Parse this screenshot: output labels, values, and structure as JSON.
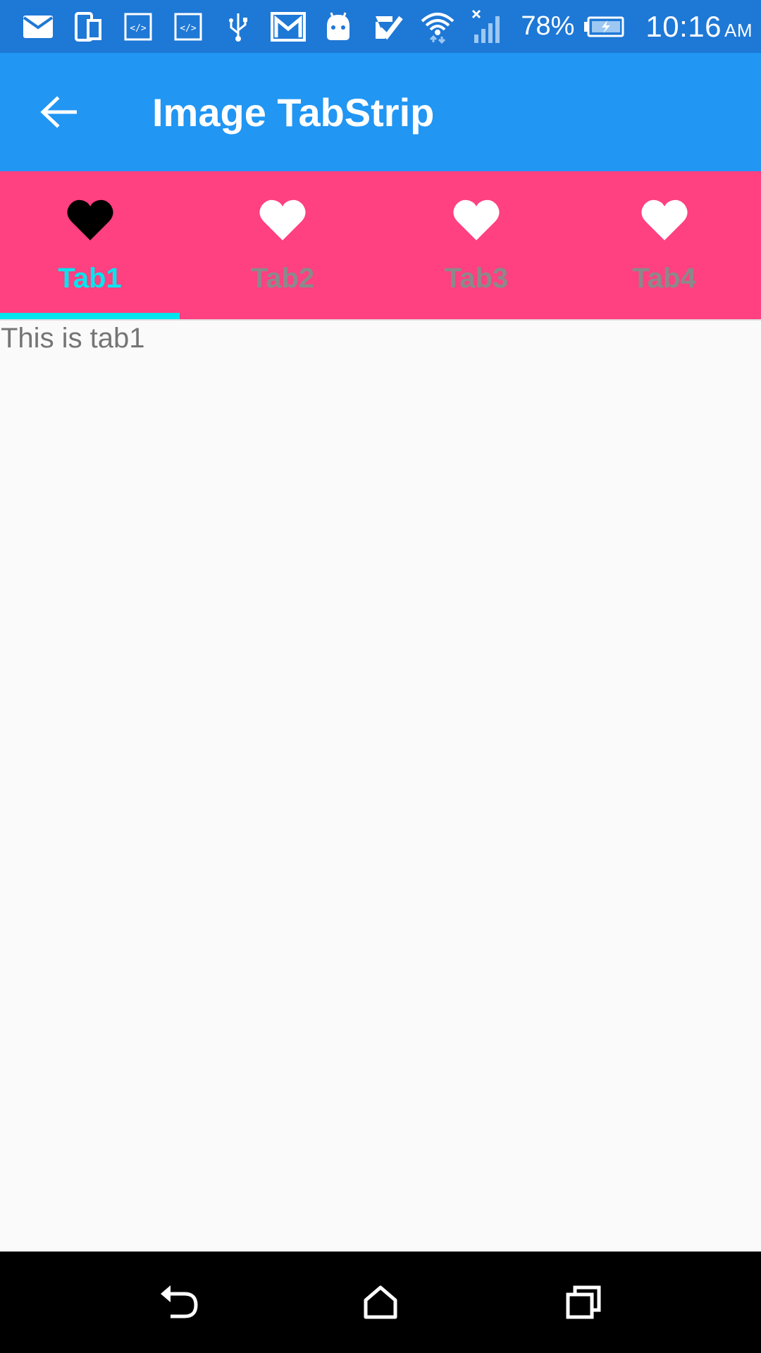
{
  "status_bar": {
    "icons": [
      "mail-icon",
      "phone-tablet-icon",
      "code-icon",
      "code-icon",
      "usb-icon",
      "gmail-icon",
      "android-icon",
      "check-icon",
      "wifi-icon",
      "signal-icon",
      "battery-charging-icon"
    ],
    "battery_percent": "78%",
    "time": "10:16",
    "ampm": "AM",
    "color": "#1e78d6"
  },
  "app_bar": {
    "title": "Image TabStrip",
    "back_icon": "arrow-back-icon",
    "color": "#2196f3"
  },
  "tab_strip": {
    "color": "#ff4081",
    "indicator_color": "#00e5ee",
    "selected_label_color": "#00e5ee",
    "unselected_label_color": "#8a8a8a",
    "tabs": [
      {
        "label": "Tab1",
        "icon": "heart-icon",
        "selected": true
      },
      {
        "label": "Tab2",
        "icon": "heart-icon",
        "selected": false
      },
      {
        "label": "Tab3",
        "icon": "heart-icon",
        "selected": false
      },
      {
        "label": "Tab4",
        "icon": "heart-icon",
        "selected": false
      }
    ]
  },
  "content": {
    "text": "This is tab1"
  },
  "nav_bar": {
    "buttons": [
      "back-nav-icon",
      "home-icon",
      "recents-icon"
    ]
  }
}
